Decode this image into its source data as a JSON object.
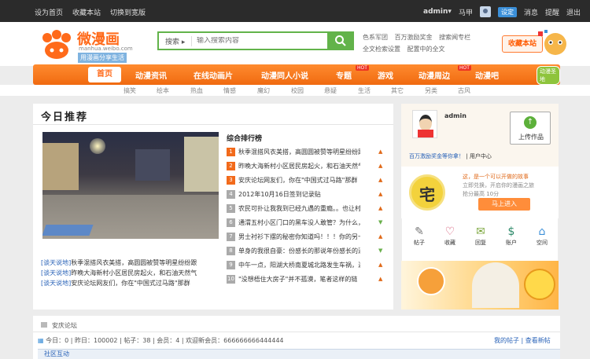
{
  "topbar": {
    "left_links": [
      "设为首页",
      "收藏本站",
      "切换到宽版"
    ],
    "user": "admin",
    "user_arrow": "▾",
    "horse": "马甲",
    "badge": "设定",
    "right_links": [
      "消息",
      "提醒",
      "退出"
    ]
  },
  "logo": {
    "title": "微漫画",
    "url": "manhua.weibo.com",
    "slogan": "用漫画分享生活"
  },
  "search": {
    "category": "搜索",
    "placeholder": "输入搜索内容"
  },
  "hot_links": [
    [
      "色系军团",
      "百万激励奖金",
      "搜索闻专栏"
    ],
    [
      "全文检索设置",
      "配置中的全文"
    ]
  ],
  "fav_button": "收藏本站",
  "nav": {
    "home": "首页",
    "items": [
      "动漫资讯",
      "在线动画片",
      "动漫同人小说",
      "专题",
      "游戏",
      "动漫周边",
      "动漫吧"
    ],
    "hot": "HOT",
    "green_tag": "动漫圣地"
  },
  "subnav": [
    "搞笑",
    "绘本",
    "热血",
    "情感",
    "魔幻",
    "校园",
    "悬疑",
    "生活",
    "其它",
    "另类",
    "古风"
  ],
  "recommend": {
    "title": "今日推荐",
    "captions": [
      {
        "tag": "[谈天说地]",
        "text": "秋季混搭风衣美搭，高圆圆被赞等明星纷纷跟"
      },
      {
        "tag": "[谈天说地]",
        "text": "昨晚大海新村小区居民房起火，和石油天然气"
      },
      {
        "tag": "[谈天说地]",
        "text": "安庆论坛网友们，你在\"中国式过马路\"那群"
      }
    ]
  },
  "ranking": {
    "title": "综合排行榜",
    "items": [
      {
        "n": "1",
        "text": "秋季混搭风衣美搭，高圆圆被赞等明星纷纷跟",
        "trend": "up"
      },
      {
        "n": "2",
        "text": "昨晚大海新村小区居民房起火，和石油天然气",
        "trend": "up"
      },
      {
        "n": "3",
        "text": "安庆论坛网友们，你在\"中国式过马路\"那群",
        "trend": "up"
      },
      {
        "n": "4",
        "text": "2012年10月16日签到记录贴",
        "trend": "up"
      },
      {
        "n": "5",
        "text": "农民可扑让我我到已经九遇的重瘾。。也让村",
        "trend": "up"
      },
      {
        "n": "6",
        "text": "通渭五村小区门口的黑车没人敢管？为什么，",
        "trend": "down"
      },
      {
        "n": "7",
        "text": "男士衬衫下摆的秘密你知道吗！！！你的另一半",
        "trend": "up"
      },
      {
        "n": "8",
        "text": "单身的我很自豪：份感长的那说年份感长的酒",
        "trend": "down"
      },
      {
        "n": "9",
        "text": "中午一点，阳湖大桥南夏城北路发生车祸，满",
        "trend": "up"
      },
      {
        "n": "10",
        "text": "\"没想梧住大房子\"并不孤漠，笔者这样的链",
        "trend": "up"
      }
    ]
  },
  "sidebar": {
    "username": "admin",
    "upload": "上传作品",
    "incentive": "百万激励奖金等你拿！",
    "user_center": "| 用户中心",
    "promo_char": "宅",
    "promo_lines": [
      "这，是一个可以开做的故事",
      "立即兑换，开启你的漫画之旅",
      "抢分最高 10分"
    ],
    "enter": "马上进入",
    "icons": [
      {
        "label": "帖子",
        "glyph": "✎"
      },
      {
        "label": "收藏",
        "glyph": "♡"
      },
      {
        "label": "回复",
        "glyph": "✉"
      },
      {
        "label": "账户",
        "glyph": "$"
      },
      {
        "label": "空间",
        "glyph": "⌂"
      }
    ]
  },
  "forum": {
    "crumb": "安庆论坛",
    "stats": {
      "today": "今日：0",
      "yesterday": "昨日：100002",
      "posts": "帖子：38",
      "members": "会员：4",
      "welcome": "欢迎新会员：666666666444444"
    },
    "my_posts": "我的帖子",
    "new_posts": "查看新帖",
    "zone": "社区互动"
  },
  "colors": {
    "accent": "#ff6a1a",
    "nav": "#f06a10",
    "link": "#2a63b8",
    "search": "#62b34a"
  }
}
